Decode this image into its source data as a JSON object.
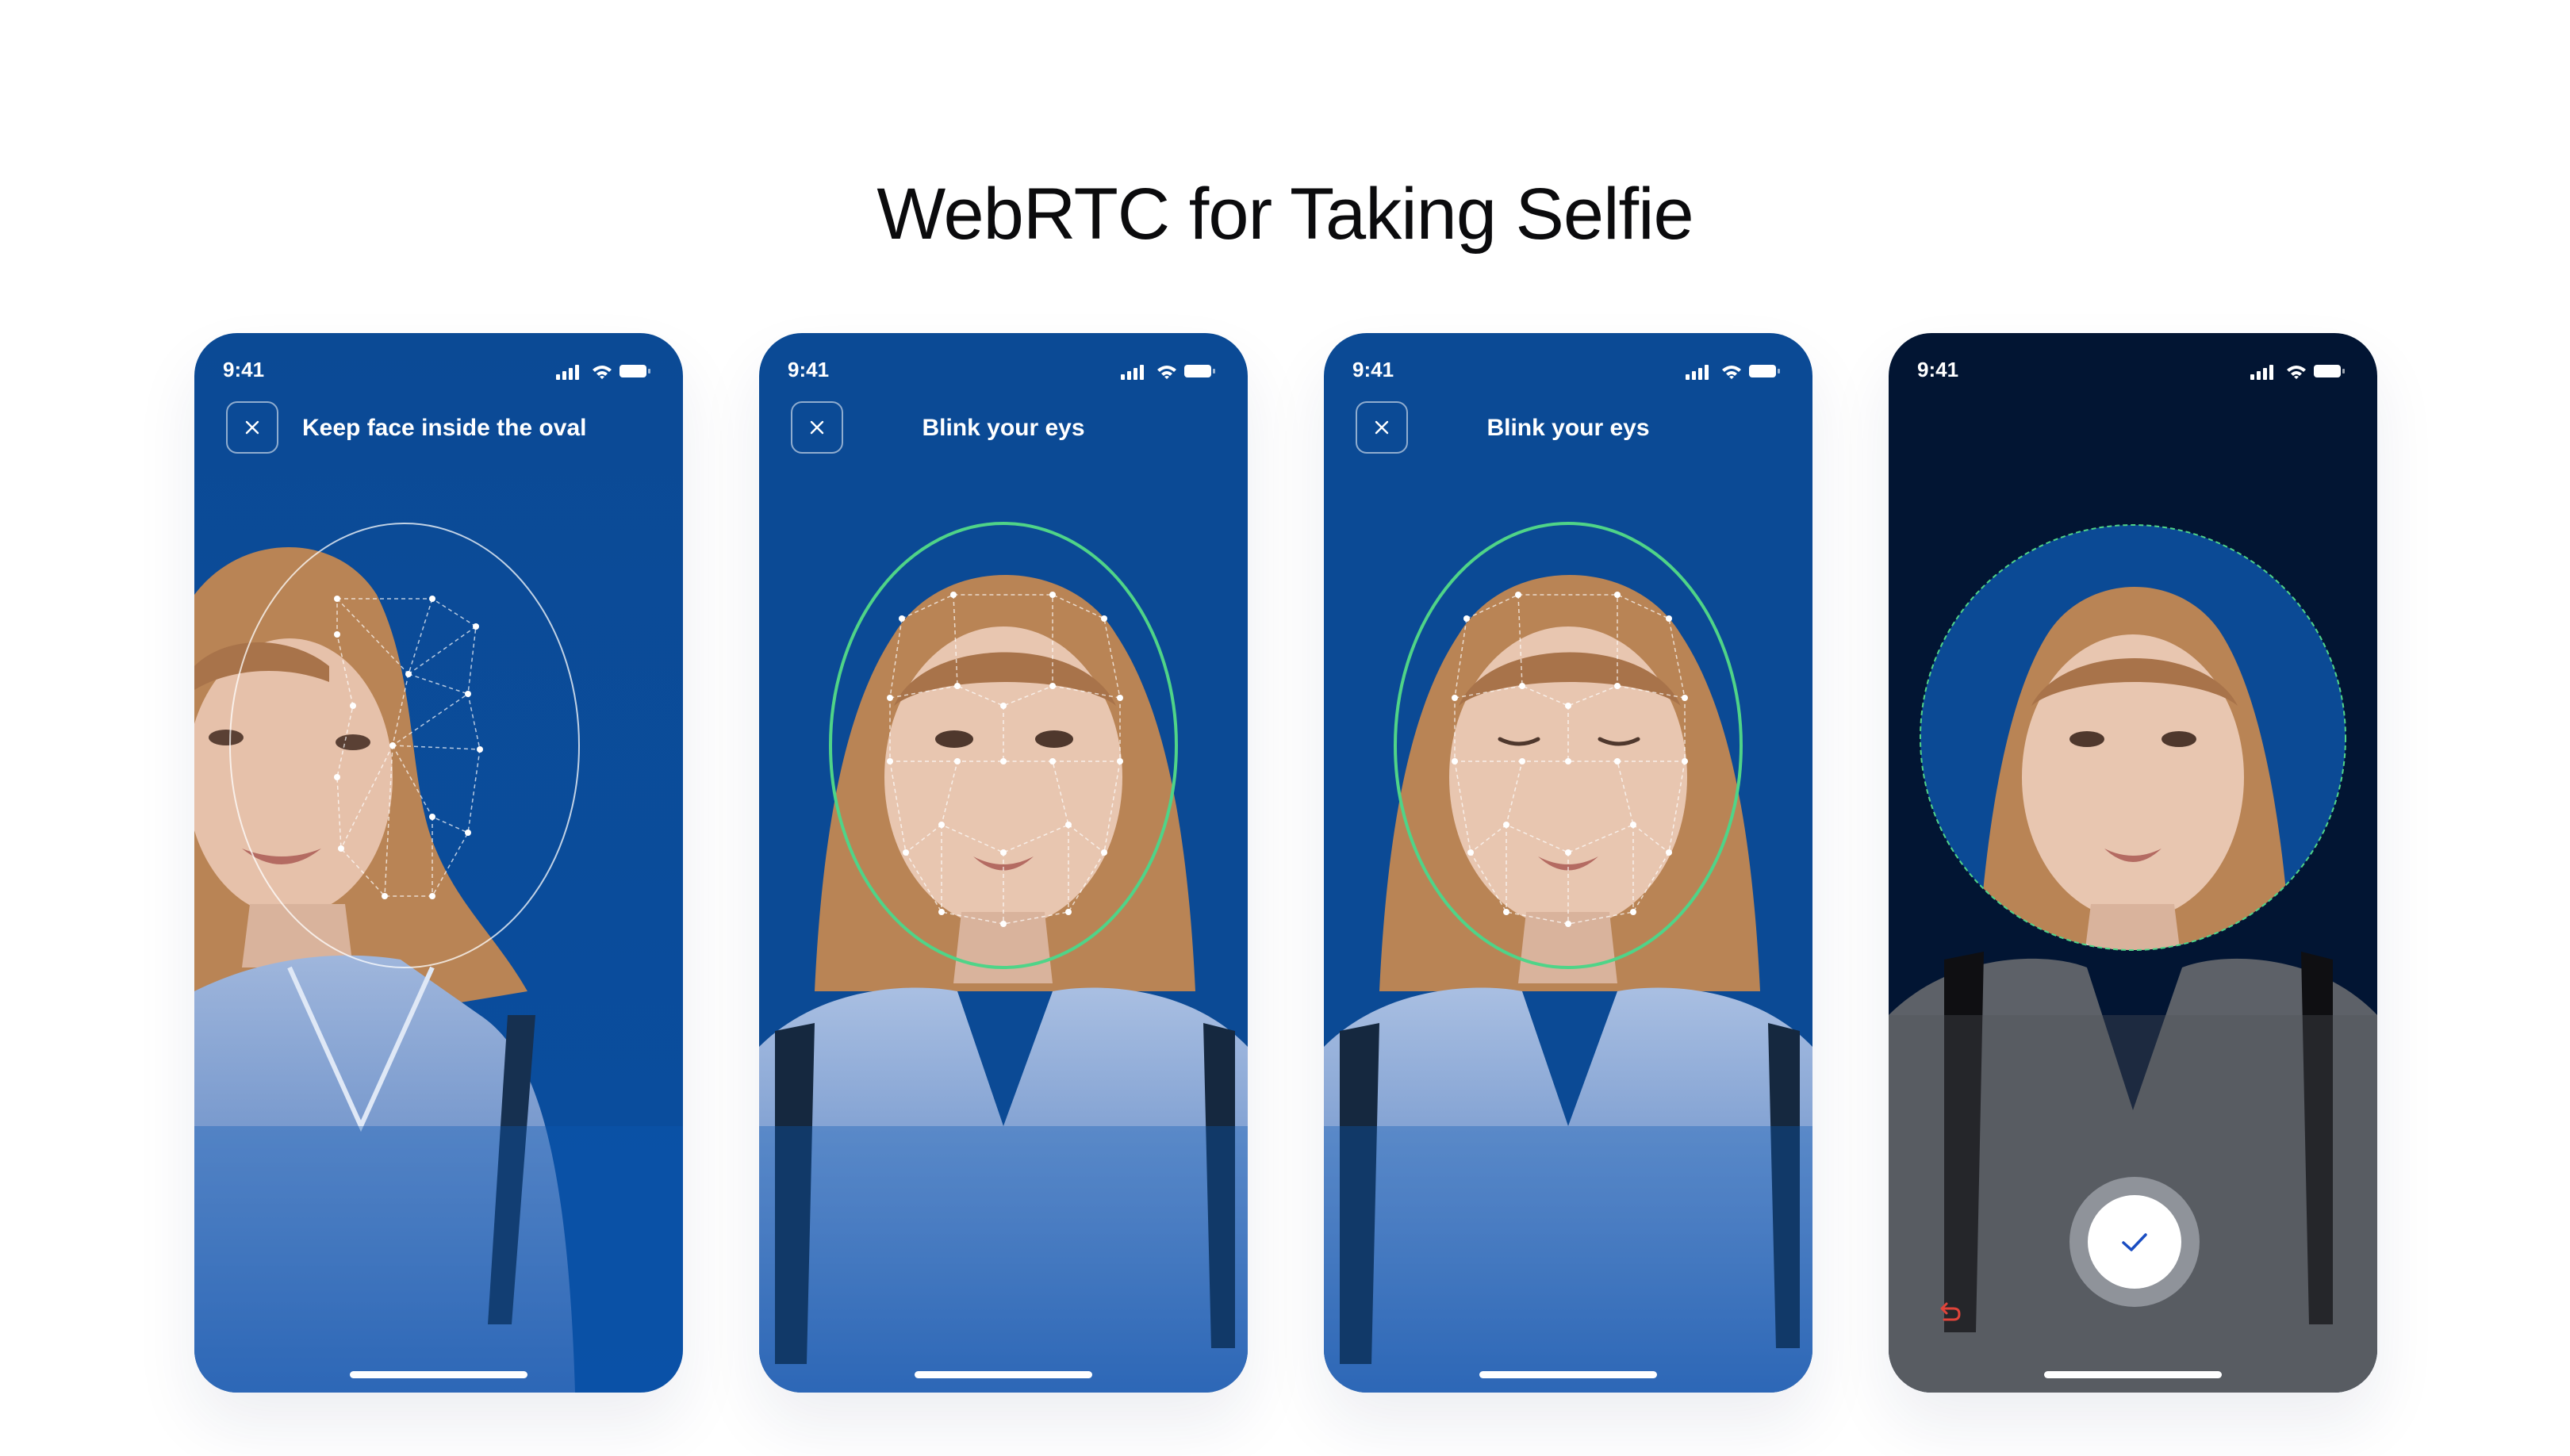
{
  "page": {
    "title": "WebRTC for Taking Selfie"
  },
  "colors": {
    "screen_blue": "#0a4a96",
    "screen_navy": "#021533",
    "oval_white": "#ffffff",
    "oval_green": "#4fd488",
    "undo_red": "#e0443a",
    "check_blue": "#1a4dc2"
  },
  "screens": [
    {
      "status_time": "9:41",
      "instruction": "Keep face inside the oval",
      "close_icon": "close-icon",
      "oval_state": "misaligned"
    },
    {
      "status_time": "9:41",
      "instruction": "Blink your eys",
      "close_icon": "close-icon",
      "oval_state": "aligned"
    },
    {
      "status_time": "9:41",
      "instruction": "Blink your eys",
      "close_icon": "close-icon",
      "oval_state": "aligned-eyes-closed"
    },
    {
      "status_time": "9:41",
      "capture_icon": "checkmark-icon",
      "undo_icon": "undo-arrow-icon",
      "oval_state": "captured"
    }
  ]
}
